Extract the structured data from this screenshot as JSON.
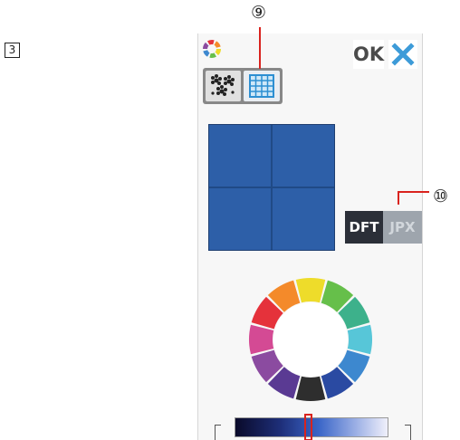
{
  "step": {
    "number": "3"
  },
  "header": {
    "ok_label": "OK",
    "palette_icon": "color-wheel-icon",
    "close_icon": "x-icon"
  },
  "tabs": [
    {
      "icon": "flower-pattern-icon",
      "active": false
    },
    {
      "icon": "grid-pattern-icon",
      "active": true
    }
  ],
  "preview": {
    "color": "#2d5fa8",
    "grid": "2x2"
  },
  "buttons": {
    "dft_label": "DFT",
    "jpx_label": "JPX"
  },
  "color_wheel": {
    "segments": [
      "#eedc2a",
      "#66bf4a",
      "#3db18b",
      "#57c6d8",
      "#3d88cf",
      "#2a4aa2",
      "#2e2e2e",
      "#5a3a93",
      "#8b4ba0",
      "#d44a94",
      "#e5323b",
      "#f48a2a"
    ]
  },
  "slider": {
    "position": 0.48,
    "colors": [
      "#0a0a2a",
      "#3b66c8",
      "#f0f0fb"
    ]
  },
  "callouts": {
    "nine": "⑨",
    "ten": "⑩"
  },
  "colors": {
    "accent": "#3d9bd8",
    "indicator": "#d9231e"
  }
}
